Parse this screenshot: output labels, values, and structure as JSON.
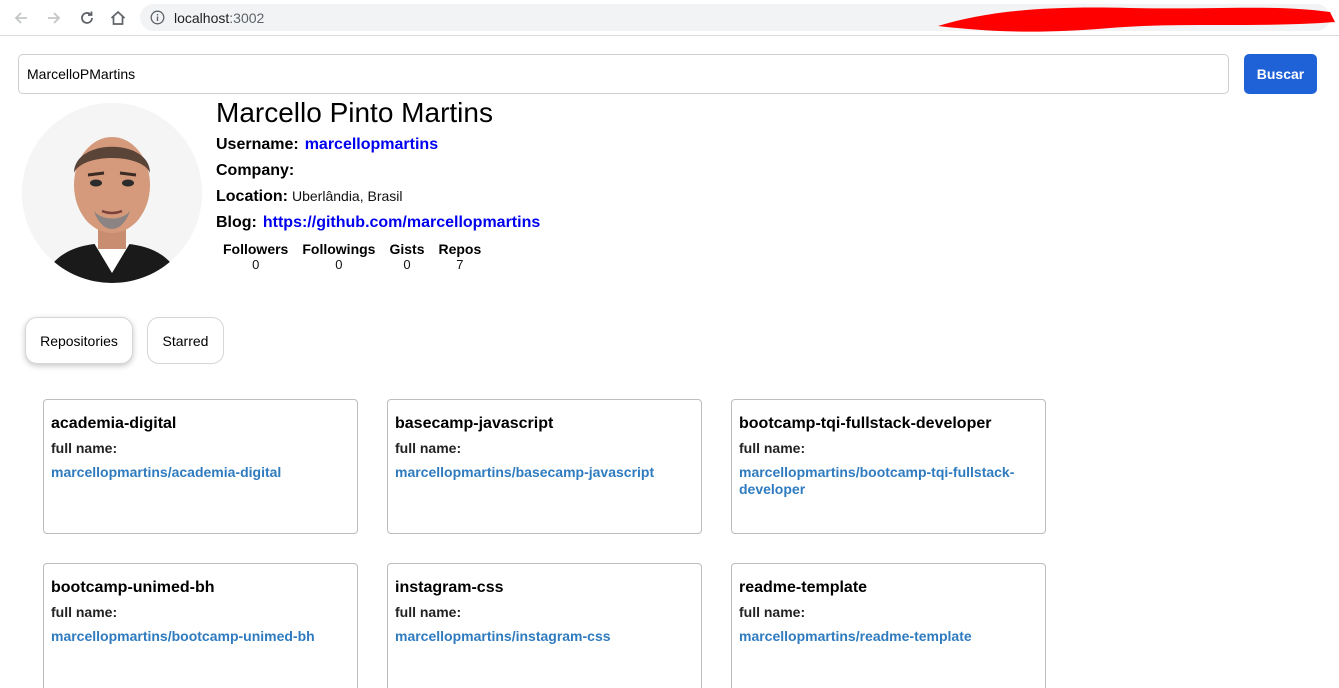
{
  "browser": {
    "url_host": "localhost",
    "url_port": ":3002"
  },
  "search": {
    "value": "MarcelloPMartins",
    "button_label": "Buscar"
  },
  "profile": {
    "name": "Marcello Pinto Martins",
    "username_label": "Username:",
    "username": "marcellopmartins",
    "company_label": "Company:",
    "company": "",
    "location_label": "Location:",
    "location": "Uberlândia, Brasil",
    "blog_label": "Blog:",
    "blog": "https://github.com/marcellopmartins",
    "stats": [
      {
        "label": "Followers",
        "value": "0"
      },
      {
        "label": "Followings",
        "value": "0"
      },
      {
        "label": "Gists",
        "value": "0"
      },
      {
        "label": "Repos",
        "value": "7"
      }
    ]
  },
  "tabs": [
    {
      "label": "Repositories"
    },
    {
      "label": "Starred"
    }
  ],
  "repositories": [
    {
      "name": "academia-digital",
      "full_name_label": "full name:",
      "full_name": "marcellopmartins/academia-digital"
    },
    {
      "name": "basecamp-javascript",
      "full_name_label": "full name:",
      "full_name": "marcellopmartins/basecamp-javascript"
    },
    {
      "name": "bootcamp-tqi-fullstack-developer",
      "full_name_label": "full name:",
      "full_name": "marcellopmartins/bootcamp-tqi-fullstack-developer"
    },
    {
      "name": "bootcamp-unimed-bh",
      "full_name_label": "full name:",
      "full_name": "marcellopmartins/bootcamp-unimed-bh"
    },
    {
      "name": "instagram-css",
      "full_name_label": "full name:",
      "full_name": "marcellopmartins/instagram-css"
    },
    {
      "name": "readme-template",
      "full_name_label": "full name:",
      "full_name": "marcellopmartins/readme-template"
    }
  ],
  "colors": {
    "accent": "#1f62d8",
    "link": "#0000ee",
    "repo_link": "#2f7bbf",
    "redaction": "#ff0000"
  }
}
